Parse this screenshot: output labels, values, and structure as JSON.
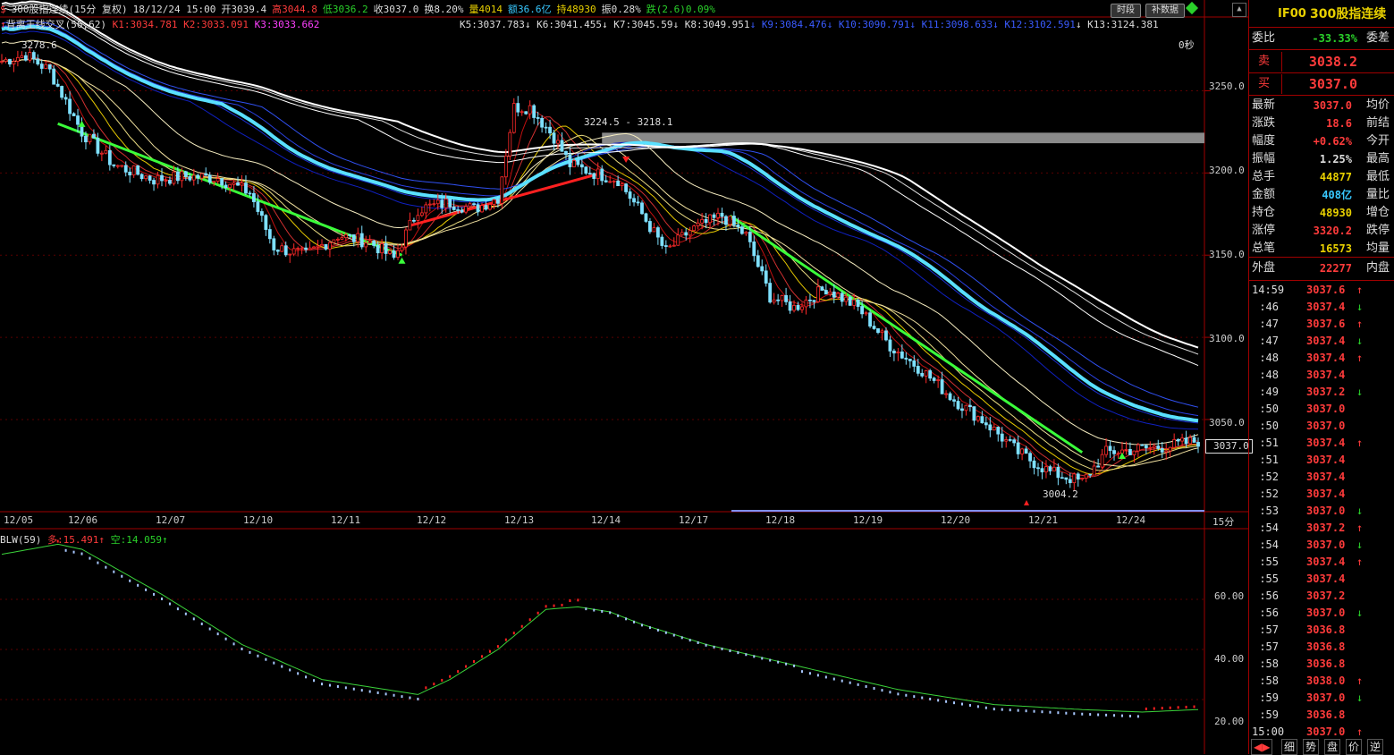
{
  "header": {
    "market_icon": "dollar-icon",
    "symbol": "300股指连续(15分 复权)",
    "datetime": "18/12/24 15:00",
    "open": "开3039.4",
    "high": "高3044.8",
    "low": "低3036.2",
    "close": "收3037.0",
    "turnover": "换8.20%",
    "volume": "量4014",
    "amount": "额36.6亿",
    "position": "持48930",
    "amplitude": "振0.28%",
    "change": "跌(2.6)0.09%",
    "btn_time": "时段",
    "btn_fill": "补数据"
  },
  "indicator_line": {
    "name": "背离王线交叉(56,62)",
    "k1": "K1:3034.781",
    "k2": "K2:3033.091",
    "k3": "K3:3033.662",
    "k5": "K5:3037.783",
    "k6": "K6:3041.455",
    "k7": "K7:3045.59",
    "k8": "K8:3049.951",
    "k9": "K9:3084.476",
    "k10": "K10:3090.791",
    "k11": "K11:3098.633",
    "k12": "K12:3102.591",
    "k13": "K13:3124.381"
  },
  "countdown": "0秒",
  "annotations": {
    "high_label": "3278.6",
    "range_label": "3224.5 - 3218.1",
    "low_label": "3004.2",
    "last_price_tag": "3037.0"
  },
  "price_axis": [
    "3250.0",
    "3200.0",
    "3150.0",
    "3100.0",
    "3050.0"
  ],
  "dates": [
    "12/05",
    "12/06",
    "12/07",
    "12/10",
    "12/11",
    "12/12",
    "12/13",
    "12/14",
    "12/17",
    "12/18",
    "12/19",
    "12/20",
    "12/21",
    "12/24"
  ],
  "period_label": "15分",
  "sub_indicator": {
    "name": "BLW(59)",
    "long": "多:15.491",
    "short": "空:14.059",
    "axis": [
      "60.00",
      "40.00",
      "20.00"
    ]
  },
  "panel": {
    "code": "IF00",
    "name": "300股指连续",
    "weibi_label": "委比",
    "weibi_value": "-33.33%",
    "weicha_label": "委差",
    "sell_label": "卖",
    "sell_price": "3038.2",
    "buy_label": "买",
    "buy_price": "3037.0",
    "stats": [
      {
        "l": "最新",
        "v": "3037.0",
        "c": "#ff3b3b",
        "r": "均价"
      },
      {
        "l": "涨跌",
        "v": "18.6",
        "c": "#ff3b3b",
        "r": "前结"
      },
      {
        "l": "幅度",
        "v": "+0.62%",
        "c": "#ff3b3b",
        "r": "今开"
      },
      {
        "l": "振幅",
        "v": "1.25%",
        "c": "#dddddd",
        "r": "最高"
      },
      {
        "l": "总手",
        "v": "44877",
        "c": "#e8d000",
        "r": "最低"
      },
      {
        "l": "金额",
        "v": "408亿",
        "c": "#38c8ff",
        "r": "量比"
      },
      {
        "l": "持仓",
        "v": "48930",
        "c": "#e8d000",
        "r": "增仓"
      },
      {
        "l": "涨停",
        "v": "3320.2",
        "c": "#ff3b3b",
        "r": "跌停"
      },
      {
        "l": "总笔",
        "v": "16573",
        "c": "#e8d000",
        "r": "均量"
      }
    ],
    "outer_label": "外盘",
    "outer_value": "22277",
    "inner_label": "内盘",
    "ticks": [
      {
        "t": "14:59",
        "p": "3037.6",
        "a": "↑",
        "c": "#ff3b3b"
      },
      {
        "t": ":46",
        "p": "3037.4",
        "a": "↓",
        "c": "#2ad12a"
      },
      {
        "t": ":47",
        "p": "3037.6",
        "a": "↑",
        "c": "#ff3b3b"
      },
      {
        "t": ":47",
        "p": "3037.4",
        "a": "↓",
        "c": "#2ad12a"
      },
      {
        "t": ":48",
        "p": "3037.4",
        "a": "↑",
        "c": "#ff3b3b"
      },
      {
        "t": ":48",
        "p": "3037.4",
        "a": "",
        "c": ""
      },
      {
        "t": ":49",
        "p": "3037.2",
        "a": "↓",
        "c": "#2ad12a"
      },
      {
        "t": ":50",
        "p": "3037.0",
        "a": "",
        "c": ""
      },
      {
        "t": ":50",
        "p": "3037.0",
        "a": "",
        "c": ""
      },
      {
        "t": ":51",
        "p": "3037.4",
        "a": "↑",
        "c": "#ff3b3b"
      },
      {
        "t": ":51",
        "p": "3037.4",
        "a": "",
        "c": ""
      },
      {
        "t": ":52",
        "p": "3037.4",
        "a": "",
        "c": ""
      },
      {
        "t": ":52",
        "p": "3037.4",
        "a": "",
        "c": ""
      },
      {
        "t": ":53",
        "p": "3037.0",
        "a": "↓",
        "c": "#2ad12a"
      },
      {
        "t": ":54",
        "p": "3037.2",
        "a": "↑",
        "c": "#ff3b3b"
      },
      {
        "t": ":54",
        "p": "3037.0",
        "a": "↓",
        "c": "#2ad12a"
      },
      {
        "t": ":55",
        "p": "3037.4",
        "a": "↑",
        "c": "#ff3b3b"
      },
      {
        "t": ":55",
        "p": "3037.4",
        "a": "",
        "c": ""
      },
      {
        "t": ":56",
        "p": "3037.2",
        "a": "",
        "c": ""
      },
      {
        "t": ":56",
        "p": "3037.0",
        "a": "↓",
        "c": "#2ad12a"
      },
      {
        "t": ":57",
        "p": "3036.8",
        "a": "",
        "c": ""
      },
      {
        "t": ":57",
        "p": "3036.8",
        "a": "",
        "c": ""
      },
      {
        "t": ":58",
        "p": "3036.8",
        "a": "",
        "c": ""
      },
      {
        "t": ":58",
        "p": "3038.0",
        "a": "↑",
        "c": "#ff3b3b"
      },
      {
        "t": ":59",
        "p": "3037.0",
        "a": "↓",
        "c": "#2ad12a"
      },
      {
        "t": ":59",
        "p": "3036.8",
        "a": "",
        "c": ""
      },
      {
        "t": "15:00",
        "p": "3037.0",
        "a": "↑",
        "c": "#ff3b3b"
      }
    ],
    "tabs": [
      "细",
      "势",
      "盘",
      "价",
      "逆"
    ]
  },
  "chart_data": {
    "type": "candlestick",
    "ylim": [
      2995,
      3290
    ],
    "sub_ylim": [
      0,
      85
    ],
    "high": 3278.6,
    "low": 3004.2,
    "range_band": [
      3218.1,
      3224.5
    ],
    "last": 3037.0,
    "anchors": [
      [
        0,
        3268
      ],
      [
        6,
        3272
      ],
      [
        12,
        3262
      ],
      [
        20,
        3225
      ],
      [
        28,
        3205
      ],
      [
        38,
        3196
      ],
      [
        46,
        3198
      ],
      [
        54,
        3197
      ],
      [
        62,
        3188
      ],
      [
        68,
        3155
      ],
      [
        76,
        3150
      ],
      [
        84,
        3162
      ],
      [
        92,
        3158
      ],
      [
        98,
        3148
      ],
      [
        104,
        3178
      ],
      [
        112,
        3182
      ],
      [
        118,
        3178
      ],
      [
        124,
        3185
      ],
      [
        128,
        3240
      ],
      [
        132,
        3240
      ],
      [
        138,
        3222
      ],
      [
        142,
        3205
      ],
      [
        148,
        3200
      ],
      [
        154,
        3196
      ],
      [
        160,
        3175
      ],
      [
        166,
        3152
      ],
      [
        172,
        3165
      ],
      [
        180,
        3174
      ],
      [
        186,
        3162
      ],
      [
        192,
        3125
      ],
      [
        198,
        3118
      ],
      [
        206,
        3130
      ],
      [
        214,
        3118
      ],
      [
        222,
        3095
      ],
      [
        230,
        3080
      ],
      [
        238,
        3062
      ],
      [
        246,
        3048
      ],
      [
        254,
        3030
      ],
      [
        262,
        3018
      ],
      [
        270,
        3012
      ],
      [
        276,
        3030
      ],
      [
        284,
        3032
      ],
      [
        292,
        3034
      ],
      [
        299,
        3037
      ]
    ],
    "blw_anchors": [
      [
        0,
        78
      ],
      [
        14,
        82
      ],
      [
        20,
        80
      ],
      [
        40,
        62
      ],
      [
        60,
        42
      ],
      [
        80,
        28
      ],
      [
        96,
        24
      ],
      [
        104,
        22
      ],
      [
        112,
        28
      ],
      [
        124,
        40
      ],
      [
        136,
        56
      ],
      [
        144,
        57
      ],
      [
        152,
        55
      ],
      [
        160,
        50
      ],
      [
        176,
        42
      ],
      [
        200,
        33
      ],
      [
        224,
        24
      ],
      [
        248,
        18
      ],
      [
        270,
        16
      ],
      [
        285,
        15
      ],
      [
        299,
        16
      ]
    ]
  }
}
